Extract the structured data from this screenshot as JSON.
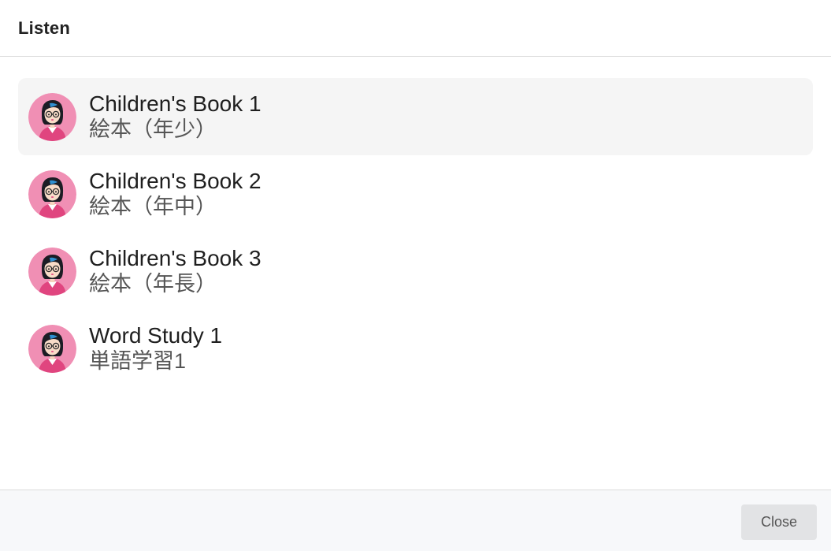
{
  "dialog": {
    "title": "Listen"
  },
  "list": {
    "items": [
      {
        "title": "Children's Book 1",
        "subtitle": "絵本（年少）",
        "avatar_icon": "teacher-avatar-icon",
        "selected": true
      },
      {
        "title": "Children's Book 2",
        "subtitle": "絵本（年中）",
        "avatar_icon": "teacher-avatar-icon",
        "selected": false
      },
      {
        "title": "Children's Book 3",
        "subtitle": "絵本（年長）",
        "avatar_icon": "teacher-avatar-icon",
        "selected": false
      },
      {
        "title": "Word Study 1",
        "subtitle": "単語学習1",
        "avatar_icon": "teacher-avatar-icon",
        "selected": false
      }
    ]
  },
  "footer": {
    "close_label": "Close"
  },
  "colors": {
    "avatar_background": "#f08fb4",
    "avatar_shirt": "#e0457f",
    "selected_row": "#f5f5f5",
    "footer_background": "#f7f8fa",
    "close_button": "#e2e3e5"
  }
}
